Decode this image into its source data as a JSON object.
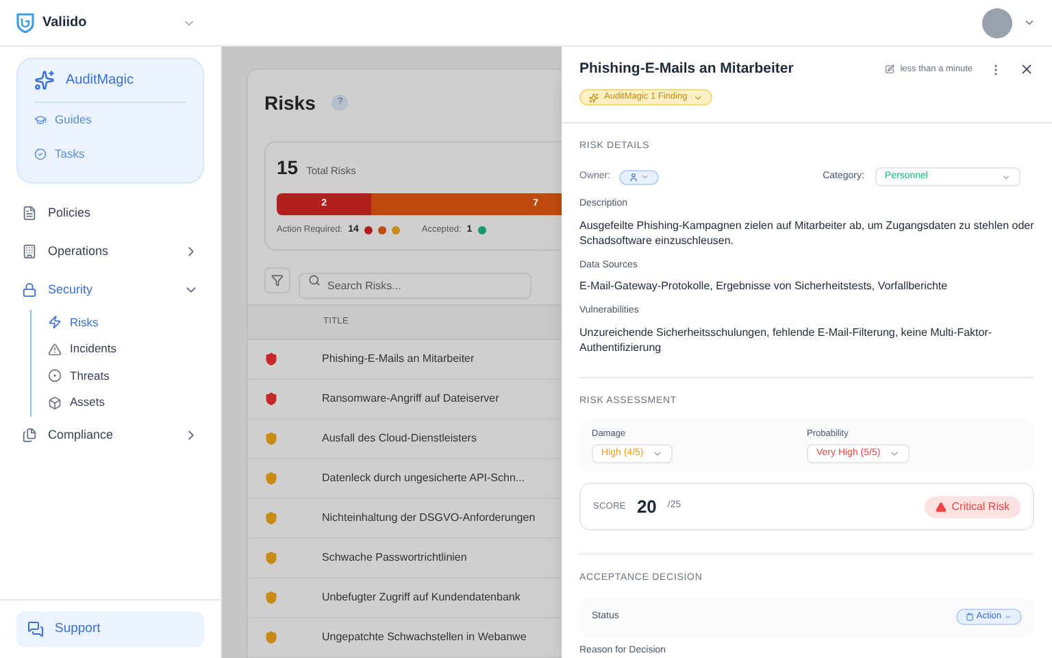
{
  "app": {
    "name": "Valiido"
  },
  "sidebar": {
    "magic": {
      "title": "AuditMagic",
      "items": [
        {
          "label": "Guides"
        },
        {
          "label": "Tasks"
        }
      ]
    },
    "items": [
      {
        "label": "Policies",
        "kind": "link"
      },
      {
        "label": "Operations",
        "kind": "group",
        "expanded": false
      },
      {
        "label": "Security",
        "kind": "group",
        "expanded": true,
        "children": [
          {
            "label": "Risks",
            "selected": true
          },
          {
            "label": "Incidents",
            "selected": false
          },
          {
            "label": "Threats",
            "selected": false
          },
          {
            "label": "Assets",
            "selected": false
          }
        ]
      },
      {
        "label": "Compliance",
        "kind": "group",
        "expanded": false
      }
    ],
    "support": "Support"
  },
  "page": {
    "title": "Risks",
    "help": "?",
    "summary": {
      "count": "15",
      "label": "Total Risks",
      "segments": [
        {
          "label": "2",
          "color": "#b21f1f",
          "level": 0.133
        },
        {
          "label": "7",
          "color": "#bf4a0e"
        }
      ],
      "legend": [
        {
          "label": "Action Required:",
          "value": "14",
          "dots": [
            {
              "color": "#b21f1f"
            },
            {
              "color": "#bf4a0e"
            },
            {
              "color": "#c98a16"
            }
          ]
        },
        {
          "label": "Accepted:",
          "value": "1",
          "dots": [
            {
              "color": "#179a68"
            }
          ]
        }
      ]
    },
    "search": {
      "placeholder": "Search Risks..."
    },
    "table": {
      "columns": [
        "TITLE"
      ],
      "rows": [
        {
          "title": "Phishing-E-Mails an Mitarbeiter",
          "color": "#c62828"
        },
        {
          "title": "Ransomware-Angriff auf Dateiserver",
          "color": "#c62828"
        },
        {
          "title": "Ausfall des Cloud-Dienstleisters",
          "color": "#c98a16"
        },
        {
          "title": "Datenleck durch ungesicherte API-Schn...",
          "color": "#c98a16"
        },
        {
          "title": "Nichteinhaltung der DSGVO-Anforderungen",
          "color": "#c98a16"
        },
        {
          "title": "Schwache Passwortrichtlinien",
          "color": "#c98a16"
        },
        {
          "title": "Unbefugter Zugriff auf Kundendatenbank",
          "color": "#c98a16"
        },
        {
          "title": "Ungepatchte Schwachstellen in Webanwe",
          "color": "#c98a16"
        }
      ]
    }
  },
  "drawer": {
    "title": "Phishing-E-Mails an Mitarbeiter",
    "updated": "less than a minute",
    "finding": "AuditMagic 1 Finding",
    "details": {
      "heading": "RISK DETAILS",
      "owner_label": "Owner:",
      "category_label": "Category:",
      "category": "Personnel",
      "fields": [
        {
          "label": "Description",
          "text": "Ausgefeilte Phishing-Kampagnen zielen auf Mitarbeiter ab, um Zugangsdaten zu stehlen oder Schadsoftware einzuschleusen."
        },
        {
          "label": "Data Sources",
          "text": "E-Mail-Gateway-Protokolle, Ergebnisse von Sicherheitstests, Vorfallberichte"
        },
        {
          "label": "Vulnerabilities",
          "text": "Unzureichende Sicherheitsschulungen, fehlende E-Mail-Filterung, keine Multi-Faktor-Authentifizierung"
        }
      ]
    },
    "assessment": {
      "heading": "RISK ASSESSMENT",
      "ratings": [
        {
          "label": "Damage",
          "value": "High (4/5)",
          "color": "#f59e0b"
        },
        {
          "label": "Probability",
          "value": "Very High (5/5)",
          "color": "#ef4444"
        }
      ],
      "score_label": "SCORE",
      "score": "20",
      "max": "/25",
      "level_badge": "Critical Risk"
    },
    "acceptance": {
      "heading": "ACCEPTANCE DECISION",
      "status_label": "Status",
      "status": "Action",
      "reason_label": "Reason for Decision"
    }
  }
}
